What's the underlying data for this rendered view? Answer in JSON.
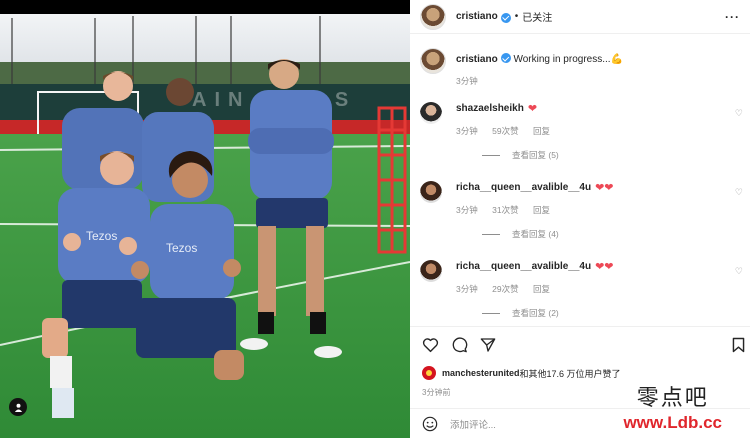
{
  "header": {
    "username": "cristiano",
    "separator": "•",
    "follow_status": "已关注",
    "more": "···"
  },
  "caption": {
    "username": "cristiano",
    "text": "Working in progress...",
    "emoji": "💪",
    "time": "3分钟"
  },
  "comments": [
    {
      "username": "shazaelsheikh",
      "text": "❤",
      "time": "3分钟",
      "likes": "59次赞",
      "reply": "回复",
      "view_replies": "查看回复 (5)"
    },
    {
      "username": "richa__queen__avalible__4u",
      "text": "❤❤",
      "time": "3分钟",
      "likes": "31次赞",
      "reply": "回复",
      "view_replies": "查看回复 (4)"
    },
    {
      "username": "richa__queen__avalible__4u",
      "text": "❤❤",
      "time": "3分钟",
      "likes": "29次赞",
      "reply": "回复",
      "view_replies": "查看回复 (2)"
    }
  ],
  "likes_line": {
    "username": "manchesterunited",
    "text": "和其他17.6 万位用户赞了"
  },
  "post_time": "3分钟前",
  "add_comment": {
    "placeholder": "添加评论..."
  },
  "photo": {
    "board_text": "AIN C   E  S",
    "shirt_sponsor": "Tezos"
  },
  "watermark": {
    "line1": "零点吧",
    "line2": "www.Ldb.cc"
  },
  "colors": {
    "verified": "#3897f0",
    "heart": "#ed4956",
    "grass": "#3c9a3c",
    "kit": "#5273b8"
  }
}
